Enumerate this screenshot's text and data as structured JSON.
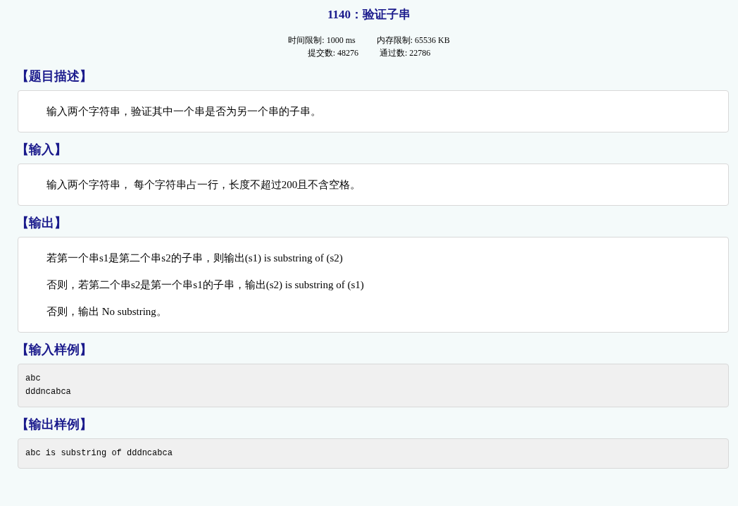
{
  "title": "1140：验证子串",
  "limits": [
    "时间限制: 1000 ms",
    "内存限制: 65536 KB"
  ],
  "counts": [
    "提交数: 48276",
    "通过数: 22786"
  ],
  "sections": [
    {
      "heading": "【题目描述】",
      "kind": "text",
      "lines": [
        "输入两个字符串，验证其中一个串是否为另一个串的子串。"
      ]
    },
    {
      "heading": "【输入】",
      "kind": "text",
      "lines": [
        "输入两个字符串， 每个字符串占一行，长度不超过200且不含空格。"
      ]
    },
    {
      "heading": "【输出】",
      "kind": "text",
      "lines": [
        "若第一个串s1是第二个串s2的子串，则输出(s1) is substring of (s2)",
        "否则，若第二个串s2是第一个串s1的子串，输出(s2) is substring of (s1)",
        "否则，输出 No substring。"
      ]
    },
    {
      "heading": "【输入样例】",
      "kind": "code",
      "lines": [
        "abc",
        "dddncabca"
      ]
    },
    {
      "heading": "【输出样例】",
      "kind": "code",
      "lines": [
        "abc is substring of dddncabca"
      ]
    }
  ]
}
